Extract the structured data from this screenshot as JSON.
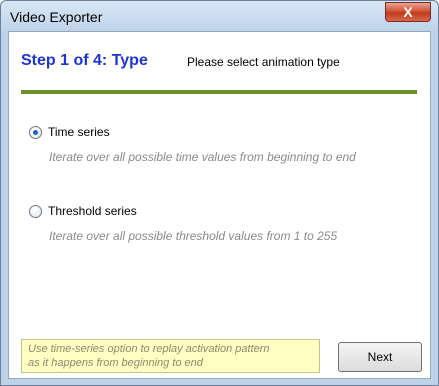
{
  "window": {
    "title": "Video Exporter",
    "close_glyph": "X"
  },
  "header": {
    "step_title": "Step 1 of 4: Type",
    "step_description": "Please select animation type"
  },
  "options": [
    {
      "label": "Time series",
      "description": "Iterate over all possible time values from beginning to end",
      "selected": true
    },
    {
      "label": "Threshold series",
      "description": "Iterate over all possible threshold values from 1 to 255",
      "selected": false
    }
  ],
  "hint": {
    "line1": "Use time-series option to replay activation pattern",
    "line2": "as it happens from beginning to end"
  },
  "buttons": {
    "next": "Next"
  },
  "colors": {
    "accent_title": "#1d35d6",
    "divider": "#69932a",
    "hint_bg": "#ffffc4"
  }
}
